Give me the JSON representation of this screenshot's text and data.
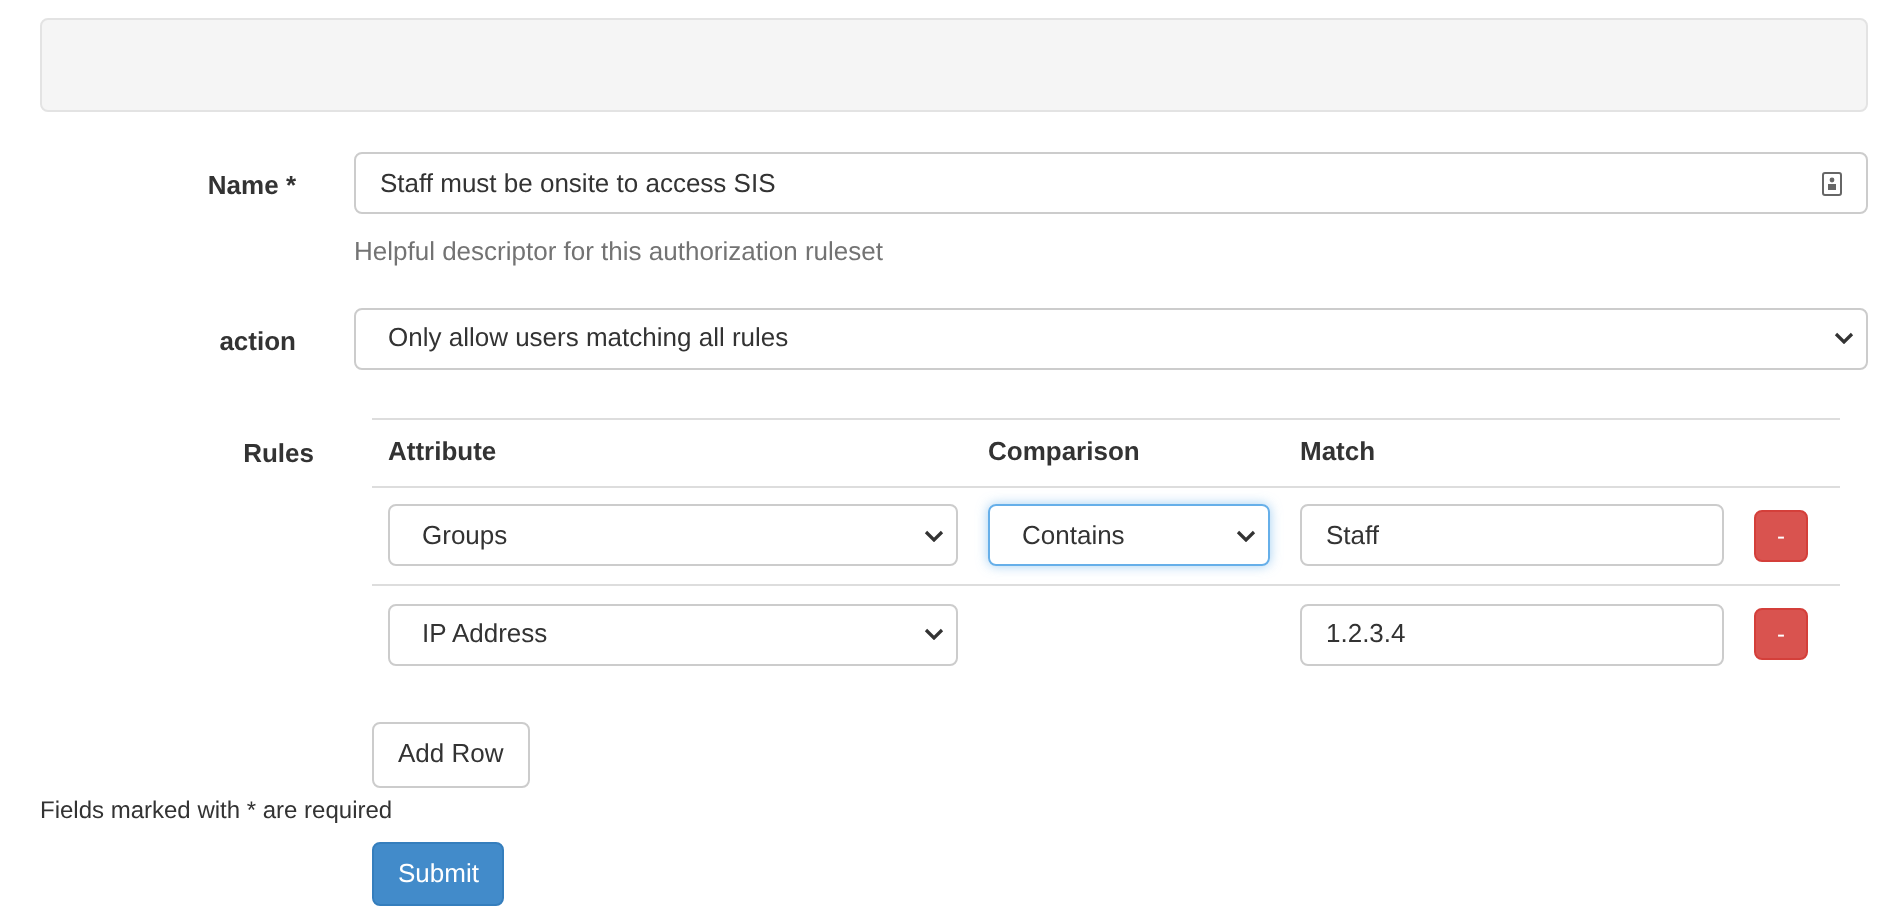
{
  "name_field": {
    "label": "Name *",
    "value": "Staff must be onsite to access SIS",
    "help": "Helpful descriptor for this authorization ruleset"
  },
  "action_field": {
    "label": "action",
    "value": "Only allow users matching all rules"
  },
  "rules": {
    "label": "Rules",
    "columns": [
      "Attribute",
      "Comparison",
      "Match"
    ],
    "rows": [
      {
        "attribute": "Groups",
        "comparison": {
          "value": "Contains",
          "focused": true
        },
        "match": "Staff",
        "remove": "-"
      },
      {
        "attribute": "IP Address",
        "match": "1.2.3.4",
        "remove": "-"
      }
    ],
    "add_button": "Add Row"
  },
  "required_note": "Fields marked with * are required",
  "submit_button": "Submit"
}
